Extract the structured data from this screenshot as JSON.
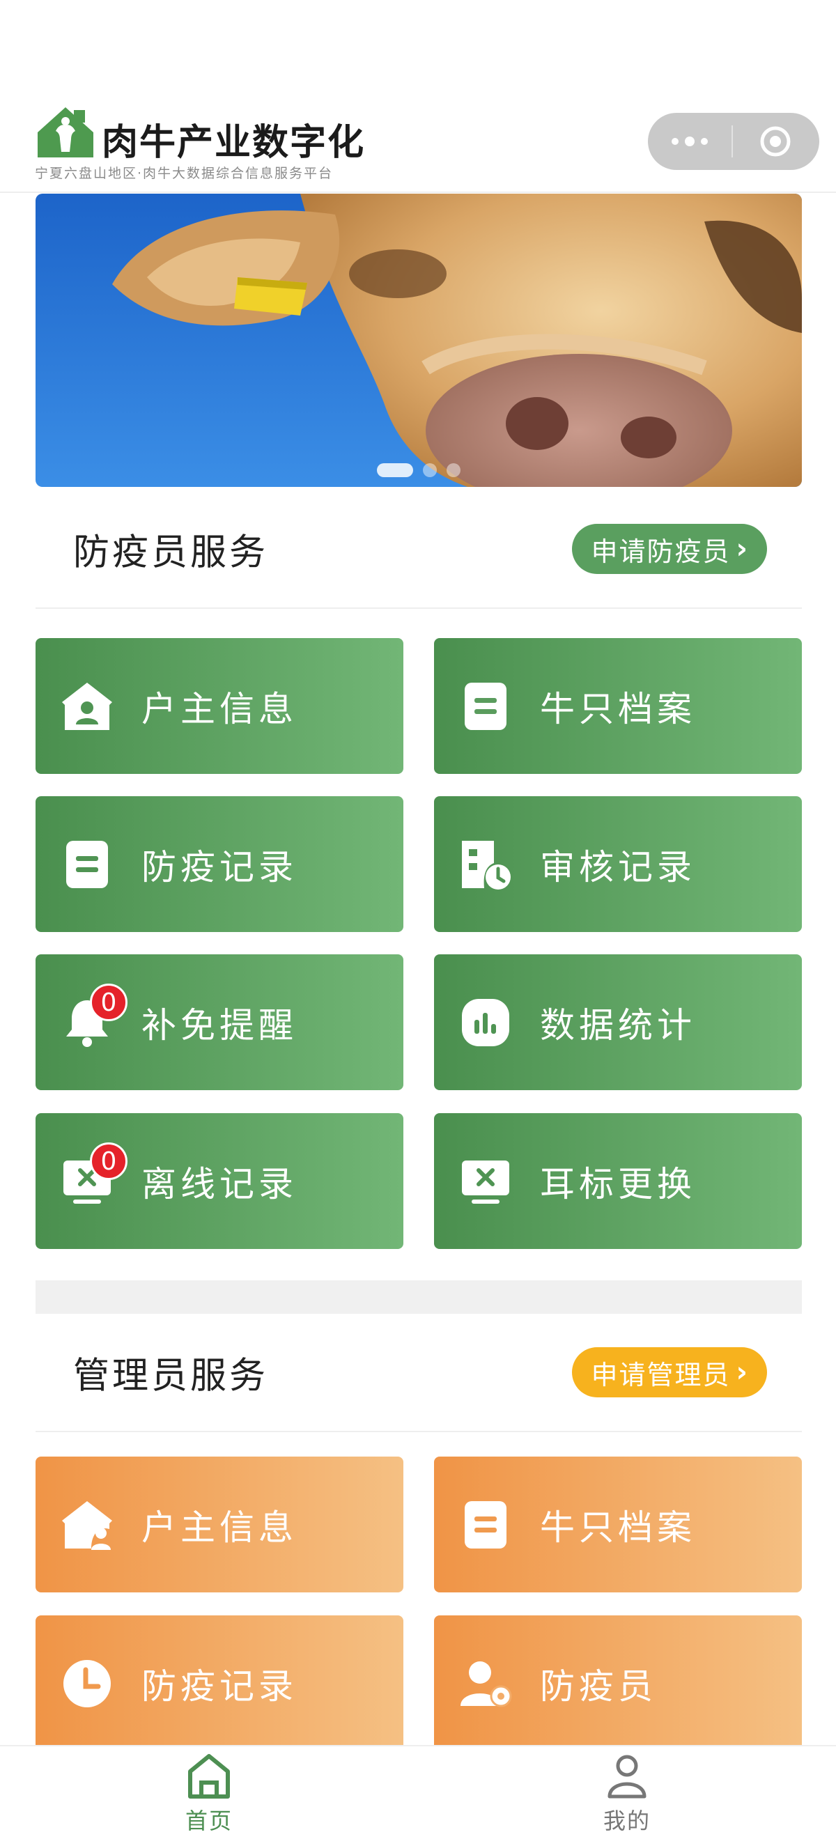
{
  "header": {
    "app_title": "肉牛产业数字化",
    "subtitle": "宁夏六盘山地区·肉牛大数据综合信息服务平台",
    "capsule_more_icon": "more-dots-icon",
    "capsule_close_icon": "target-circle-icon"
  },
  "banner": {
    "slide_count": 3,
    "active_slide": 1
  },
  "epidemic_section": {
    "title": "防疫员服务",
    "apply_label": "申请防疫员",
    "accent_color": "#5a9f5f",
    "cards": [
      {
        "label": "户主信息",
        "icon": "household-icon"
      },
      {
        "label": "牛只档案",
        "icon": "file-icon"
      },
      {
        "label": "防疫记录",
        "icon": "record-icon"
      },
      {
        "label": "审核记录",
        "icon": "audit-clock-icon"
      },
      {
        "label": "补免提醒",
        "icon": "bell-icon",
        "badge": "0"
      },
      {
        "label": "数据统计",
        "icon": "stats-icon"
      },
      {
        "label": "离线记录",
        "icon": "offline-monitor-icon",
        "badge": "0"
      },
      {
        "label": "耳标更换",
        "icon": "eartag-replace-icon"
      }
    ]
  },
  "admin_section": {
    "title": "管理员服务",
    "apply_label": "申请管理员",
    "accent_color": "#f7b21e",
    "cards": [
      {
        "label": "户主信息",
        "icon": "household-user-icon"
      },
      {
        "label": "牛只档案",
        "icon": "file-icon"
      },
      {
        "label": "防疫记录",
        "icon": "clock-icon"
      },
      {
        "label": "防疫员",
        "icon": "user-settings-icon"
      }
    ]
  },
  "tabbar": {
    "home_label": "首页",
    "mine_label": "我的",
    "active_color": "#4d8f52"
  }
}
